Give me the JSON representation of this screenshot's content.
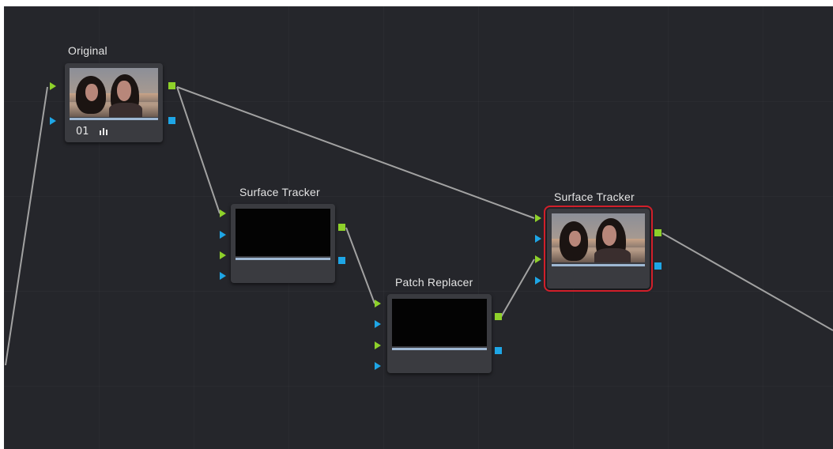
{
  "nodes": {
    "original": {
      "title": "Original",
      "label": "01",
      "label_icon": "clip-bars-icon",
      "thumbnail": "video-frame-two-people"
    },
    "surface_tracker_1": {
      "title": "Surface Tracker",
      "thumbnail": "black-frame"
    },
    "patch_replacer": {
      "title": "Patch Replacer",
      "thumbnail": "black-frame"
    },
    "surface_tracker_2": {
      "title": "Surface Tracker",
      "thumbnail": "video-frame-two-people",
      "selected": true
    }
  },
  "colors": {
    "canvas": "#25262b",
    "node": "#3a3b40",
    "wire": "#9a9a9a",
    "rgb_port": "#8ed12a",
    "key_port": "#1ea6e6",
    "selection": "#d21f2a"
  },
  "connections": [
    {
      "from": "input",
      "to": "original"
    },
    {
      "from": "original",
      "to": "surface_tracker_1"
    },
    {
      "from": "original",
      "to": "surface_tracker_2"
    },
    {
      "from": "surface_tracker_1",
      "to": "patch_replacer"
    },
    {
      "from": "patch_replacer",
      "to": "surface_tracker_2"
    },
    {
      "from": "surface_tracker_2",
      "to": "output"
    }
  ]
}
